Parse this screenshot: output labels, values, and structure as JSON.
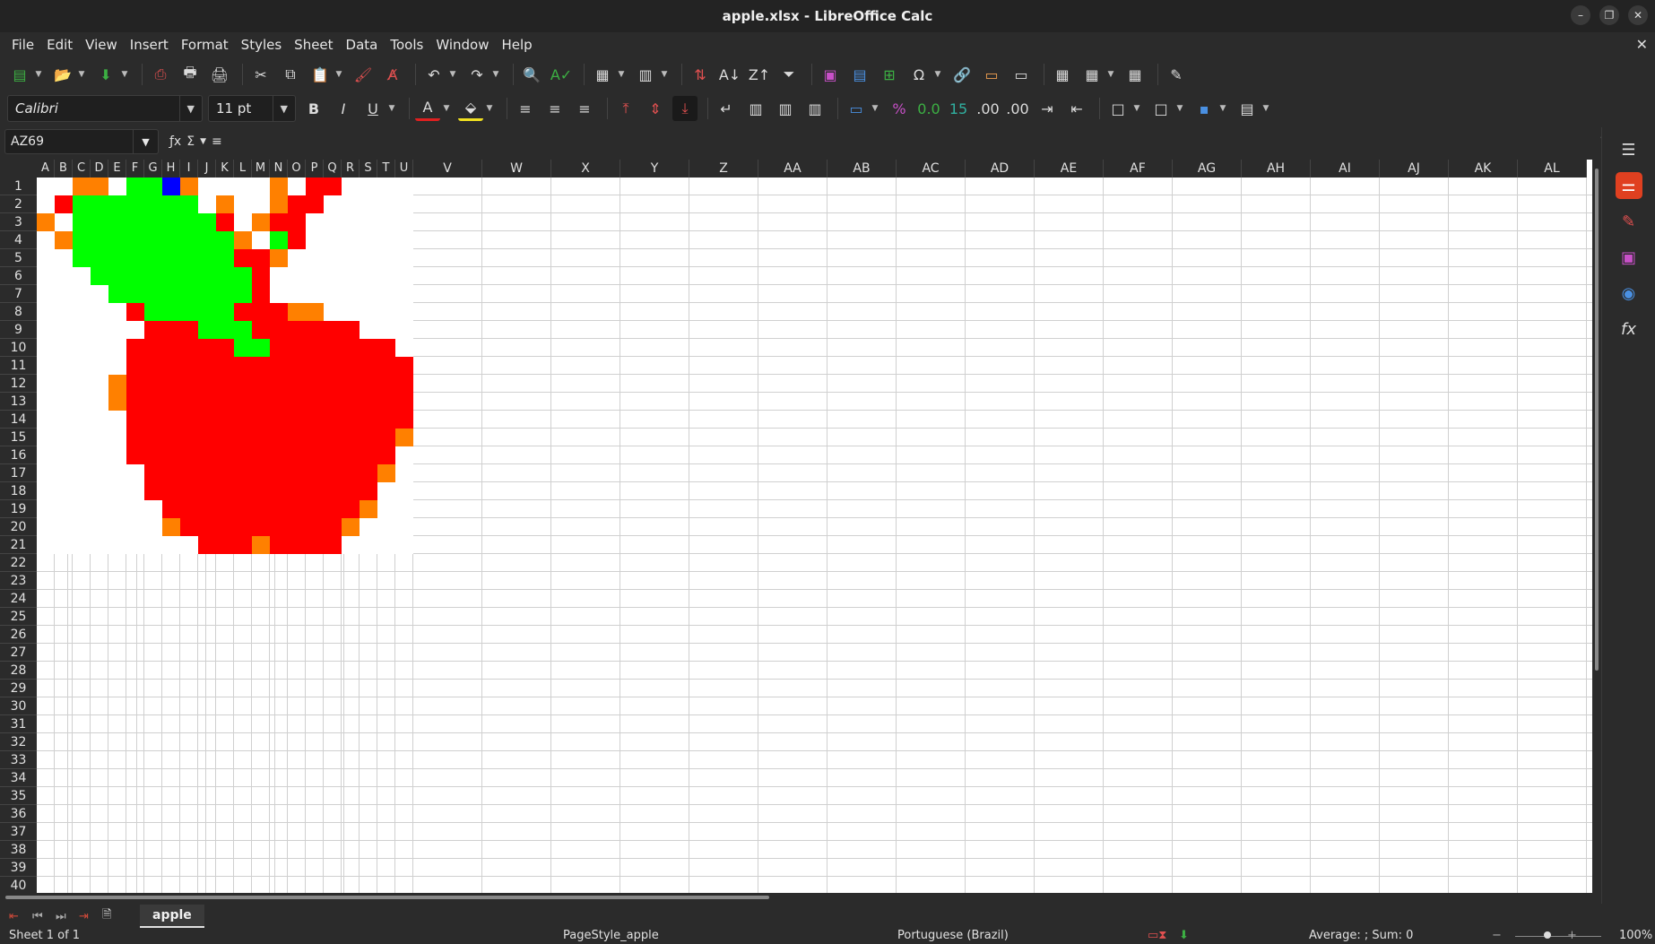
{
  "window": {
    "title": "apple.xlsx - LibreOffice Calc"
  },
  "menu": [
    "File",
    "Edit",
    "View",
    "Insert",
    "Format",
    "Styles",
    "Sheet",
    "Data",
    "Tools",
    "Window",
    "Help"
  ],
  "font": {
    "name": "Calibri",
    "size": "11 pt"
  },
  "formula_bar": {
    "cell_ref": "AZ69",
    "content": ""
  },
  "columns": [
    "A",
    "B",
    "C",
    "D",
    "E",
    "F",
    "G",
    "H",
    "I",
    "J",
    "K",
    "L",
    "M",
    "N",
    "O",
    "P",
    "Q",
    "R",
    "S",
    "T",
    "U",
    "V",
    "W",
    "X",
    "Y",
    "Z",
    "AA",
    "AB",
    "AC",
    "AD",
    "AE",
    "AF",
    "AG",
    "AH",
    "AI",
    "AJ",
    "AK",
    "AL"
  ],
  "rows": [
    "1",
    "2",
    "3",
    "4",
    "5",
    "6",
    "7",
    "8",
    "9",
    "10",
    "11",
    "12",
    "13",
    "14",
    "15",
    "16",
    "17",
    "18",
    "19",
    "20",
    "21",
    "22",
    "23",
    "24",
    "25",
    "26",
    "27",
    "28",
    "29",
    "30",
    "31",
    "32",
    "33",
    "34",
    "35",
    "36",
    "37",
    "38",
    "39",
    "40"
  ],
  "colors": {
    "red": "#ff0000",
    "green": "#00ff00",
    "orange": "#ff8000",
    "blue": "#0000ff"
  },
  "pixel_art": [
    "..OO.GGBO....O.RR....",
    ".RGGGGGGG.O..ORR.....",
    "O.GGGGGGGGR.ORR......",
    ".OGGGGGGGGGO.GR......",
    "..GGGGGGGGGRRO.......",
    "...GGGGGGGGGR........",
    "....GGGGGGGGR........",
    ".....RGGGGGRRROO.....",
    "......RRRGGGRRRRRR...",
    ".....RRRRRRGGRRRRRRR.",
    ".....RRRRRRRRRRRRRRRR",
    "....ORRRRRRRRRRRRRRRR",
    "....ORRRRRRRRRRRRRRRR",
    ".....RRRRRRRRRRRRRRRR",
    ".....RRRRRRRRRRRRRRRO",
    ".....RRRRRRRRRRRRRRR.",
    "......RRRRRRRRRRRRRO.",
    "......RRRRRRRRRRRRR..",
    ".......RRRRRRRRRRRO..",
    ".......ORRRRRRRRRO...",
    ".........RRRORRRR...."
  ],
  "sheet_tabs": [
    "apple"
  ],
  "status": {
    "sheet": "Sheet 1 of 1",
    "page_style": "PageStyle_apple",
    "language": "Portuguese (Brazil)",
    "summary": "Average: ; Sum: 0",
    "zoom": "100%"
  }
}
